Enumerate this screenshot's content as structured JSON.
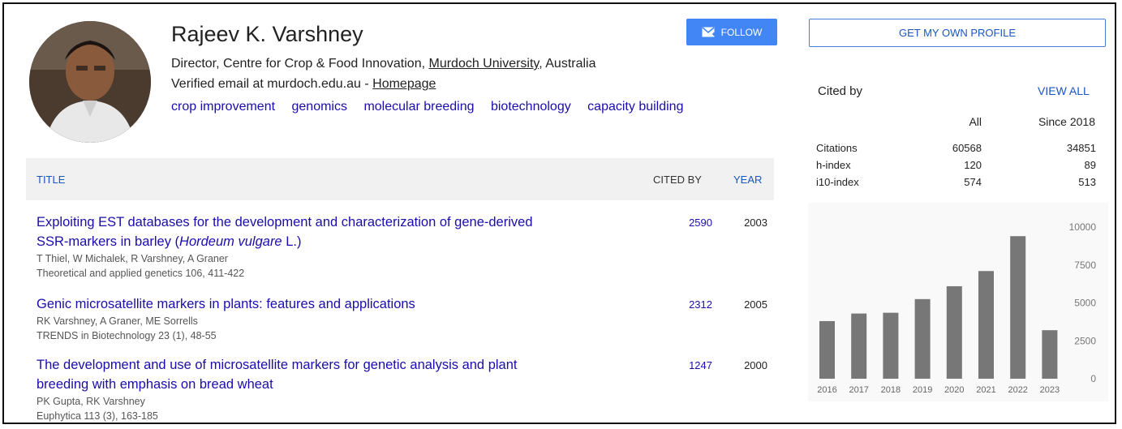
{
  "profile": {
    "name": "Rajeev K. Varshney",
    "affiliation_prefix": "Director, Centre for Crop & Food Innovation, ",
    "affiliation_link": "Murdoch University",
    "affiliation_suffix": ", Australia",
    "email_text": "Verified email at murdoch.edu.au - ",
    "homepage_label": "Homepage",
    "interests": [
      "crop improvement",
      "genomics",
      "molecular breeding",
      "biotechnology",
      "capacity building"
    ]
  },
  "buttons": {
    "follow": "FOLLOW",
    "get_own_profile": "GET MY OWN PROFILE"
  },
  "table": {
    "col_title": "TITLE",
    "col_cited_by": "CITED BY",
    "col_year": "YEAR",
    "rows": [
      {
        "title_line1": "Exploiting EST databases for the development and characterization of gene-derived",
        "title_line2_prefix": "SSR-markers in barley (",
        "title_line2_italic": "Hordeum vulgare",
        "title_line2_suffix": " L.)",
        "authors": "T Thiel, W Michalek, R Varshney, A Graner",
        "venue": "Theoretical and applied genetics 106, 411-422",
        "cited_by": "2590",
        "year": "2003"
      },
      {
        "title_line1": "Genic microsatellite markers in plants: features and applications",
        "authors": "RK Varshney, A Graner, ME Sorrells",
        "venue": "TRENDS in Biotechnology 23 (1), 48-55",
        "cited_by": "2312",
        "year": "2005"
      },
      {
        "title_line1": "The development and use of microsatellite markers for genetic analysis and plant",
        "title_line2": "breeding with emphasis on bread wheat",
        "authors": "PK Gupta, RK Varshney",
        "venue": "Euphytica 113 (3), 163-185",
        "cited_by": "1247",
        "year": "2000"
      }
    ]
  },
  "cited_by": {
    "title": "Cited by",
    "view_all": "VIEW ALL",
    "col_all": "All",
    "col_since": "Since 2018",
    "stats": [
      {
        "label": "Citations",
        "all": "60568",
        "since": "34851"
      },
      {
        "label": "h-index",
        "all": "120",
        "since": "89"
      },
      {
        "label": "i10-index",
        "all": "574",
        "since": "513"
      }
    ]
  },
  "chart_data": {
    "type": "bar",
    "categories": [
      "2016",
      "2017",
      "2018",
      "2019",
      "2020",
      "2021",
      "2022",
      "2023"
    ],
    "values": [
      3800,
      4300,
      4350,
      5250,
      6100,
      7100,
      9400,
      3200
    ],
    "yticks": [
      "10000",
      "7500",
      "5000",
      "2500",
      "0"
    ],
    "ylim": [
      0,
      10000
    ],
    "bar_color": "#777777"
  }
}
